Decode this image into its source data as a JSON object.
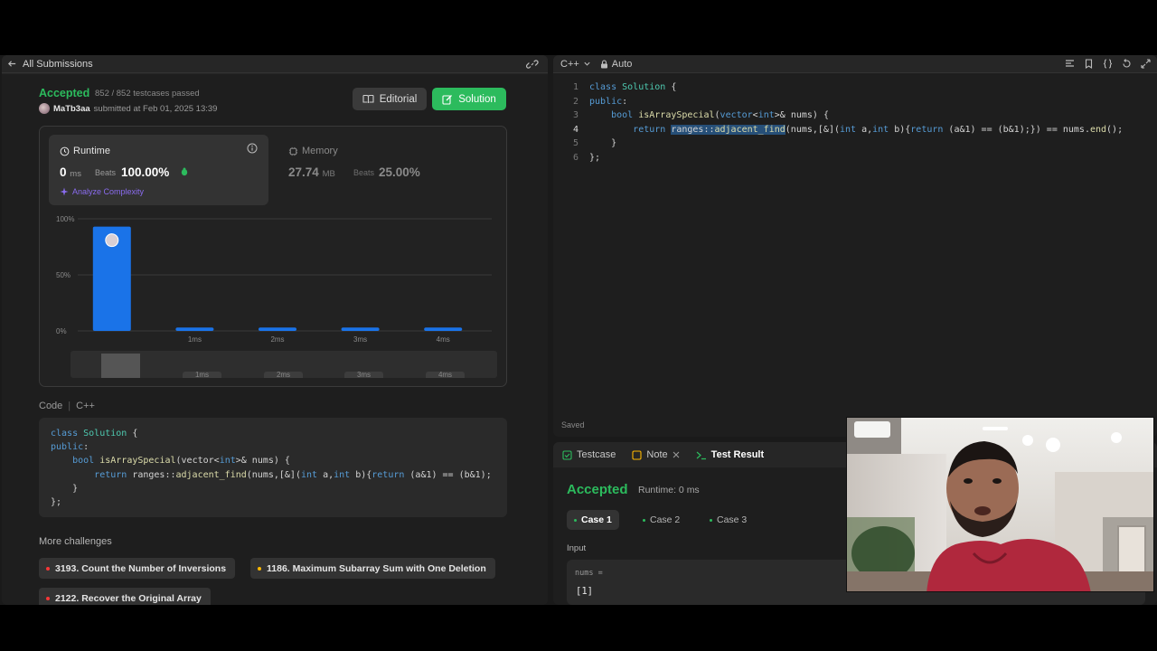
{
  "left": {
    "back_label": "All Submissions",
    "status": "Accepted",
    "testcases": "852 / 852 testcases passed",
    "user": "MaTb3aa",
    "submitted_text": "submitted at Feb 01, 2025 13:39",
    "editorial_label": "Editorial",
    "solution_label": "Solution",
    "runtime": {
      "label": "Runtime",
      "value": "0",
      "unit": "ms",
      "beats_label": "Beats",
      "beats_value": "100.00%",
      "analyze_label": "Analyze Complexity"
    },
    "memory": {
      "label": "Memory",
      "value": "27.74",
      "unit": "MB",
      "beats_label": "Beats",
      "beats_value": "25.00%"
    },
    "scrubber_labels": [
      "1ms",
      "2ms",
      "3ms",
      "4ms"
    ],
    "code_label": "Code",
    "code_lang": "C++",
    "code_lines": [
      "class Solution {",
      "public:",
      "    bool isArraySpecial(vector<int>& nums) {",
      "        return ranges::adjacent_find(nums,[&](int a,int b){return (a&1) == (b&1);",
      "    }",
      "};"
    ],
    "more_challenges_title": "More challenges",
    "challenges": [
      {
        "label": "3193. Count the Number of Inversions",
        "color": "#f63737"
      },
      {
        "label": "1186. Maximum Subarray Sum with One Deletion",
        "color": "#ffb800"
      },
      {
        "label": "2122. Recover the Original Array",
        "color": "#f63737"
      }
    ]
  },
  "chart_data": {
    "type": "bar",
    "categories": [
      "0ms",
      "1ms",
      "2ms",
      "3ms",
      "4ms"
    ],
    "tick_labels": [
      "",
      "1ms",
      "2ms",
      "3ms",
      "4ms"
    ],
    "values": [
      93,
      3,
      3,
      3,
      3
    ],
    "y_ticks": [
      "100%",
      "50%",
      "0%"
    ],
    "ylim": [
      0,
      100
    ],
    "bar_color": "#1a73e8",
    "grid": true
  },
  "editor": {
    "language": "C++",
    "mode": "Auto",
    "line_numbers": [
      "1",
      "2",
      "3",
      "4",
      "5",
      "6"
    ],
    "saved_label": "Saved"
  },
  "result": {
    "tabs": [
      "Testcase",
      "Note",
      "Test Result"
    ],
    "status": "Accepted",
    "runtime": "Runtime: 0 ms",
    "cases": [
      "Case 1",
      "Case 2",
      "Case 3"
    ],
    "input_label": "Input",
    "input_name": "nums =",
    "input_value": "[1]"
  },
  "colors": {
    "accent_green": "#2cbb5d",
    "bar_blue": "#1a73e8",
    "selection": "#264f78"
  }
}
